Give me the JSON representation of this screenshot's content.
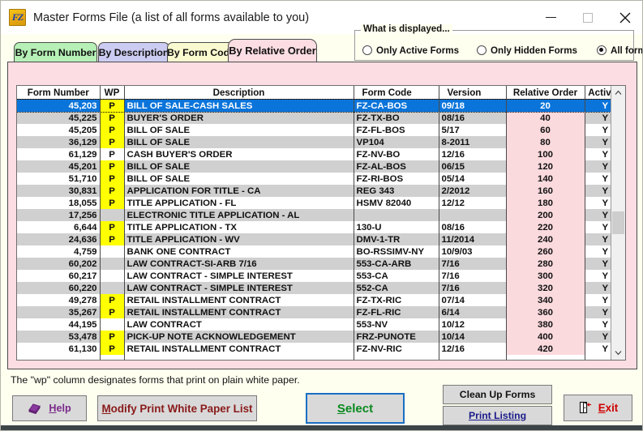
{
  "window": {
    "title": "Master Forms File (a list of all forms available to you)",
    "app_icon": "fz-app-icon",
    "controls": {
      "minimize": "minimize-icon",
      "maximize": "maximize-icon",
      "close": "close-icon"
    }
  },
  "tabs": [
    {
      "label": "By Form Number",
      "active": false,
      "color": "#b6f0b6"
    },
    {
      "label": "By Description",
      "active": false,
      "color": "#ccccf2"
    },
    {
      "label": "By Form Code",
      "active": false,
      "color": "#fafad0"
    },
    {
      "label": "By Relative Order",
      "active": true,
      "color": "#fcdde3"
    }
  ],
  "display_filter": {
    "legend": "What is displayed...",
    "options": [
      {
        "label": "Only Active Forms",
        "selected": false
      },
      {
        "label": "Only Hidden Forms",
        "selected": false
      },
      {
        "label": "All forms",
        "selected": true
      }
    ]
  },
  "grid": {
    "columns": [
      "Form Number",
      "WP",
      "Description",
      "Form Code",
      "Version",
      "Relative Order",
      "Active?"
    ],
    "rows": [
      {
        "form_number": "45,203",
        "wp": "P",
        "description": "BILL OF SALE-CASH SALES",
        "form_code": "FZ-CA-BOS",
        "version": "09/18",
        "relative_order": "20",
        "active": "Y",
        "selected": true,
        "wp_highlight": true
      },
      {
        "form_number": "45,225",
        "wp": "P",
        "description": "BUYER'S ORDER",
        "form_code": "FZ-TX-BO",
        "version": "08/16",
        "relative_order": "40",
        "active": "Y",
        "selected": false,
        "wp_highlight": true
      },
      {
        "form_number": "45,205",
        "wp": "P",
        "description": "BILL OF SALE",
        "form_code": "FZ-FL-BOS",
        "version": "5/17",
        "relative_order": "60",
        "active": "Y",
        "selected": false,
        "wp_highlight": true
      },
      {
        "form_number": "36,129",
        "wp": "P",
        "description": "BILL OF SALE",
        "form_code": "VP104",
        "version": "8-2011",
        "relative_order": "80",
        "active": "Y",
        "selected": false,
        "wp_highlight": true
      },
      {
        "form_number": "61,129",
        "wp": "P",
        "description": "CASH BUYER'S ORDER",
        "form_code": "FZ-NV-BO",
        "version": "12/16",
        "relative_order": "100",
        "active": "Y",
        "selected": false,
        "wp_highlight": false
      },
      {
        "form_number": "45,201",
        "wp": "P",
        "description": "BILL OF SALE",
        "form_code": "FZ-AL-BOS",
        "version": "06/15",
        "relative_order": "120",
        "active": "Y",
        "selected": false,
        "wp_highlight": true
      },
      {
        "form_number": "51,710",
        "wp": "P",
        "description": "BILL OF SALE",
        "form_code": "FZ-RI-BOS",
        "version": "05/14",
        "relative_order": "140",
        "active": "Y",
        "selected": false,
        "wp_highlight": true
      },
      {
        "form_number": "30,831",
        "wp": "P",
        "description": "APPLICATION FOR TITLE - CA",
        "form_code": "REG 343",
        "version": "2/2012",
        "relative_order": "160",
        "active": "Y",
        "selected": false,
        "wp_highlight": true
      },
      {
        "form_number": "18,055",
        "wp": "P",
        "description": "TITLE APPLICATION - FL",
        "form_code": "HSMV 82040",
        "version": "12/12",
        "relative_order": "180",
        "active": "Y",
        "selected": false,
        "wp_highlight": true
      },
      {
        "form_number": "17,256",
        "wp": "",
        "description": "ELECTRONIC TITLE APPLICATION - AL",
        "form_code": "",
        "version": "",
        "relative_order": "200",
        "active": "Y",
        "selected": false,
        "wp_highlight": false
      },
      {
        "form_number": "6,644",
        "wp": "P",
        "description": "TITLE APPLICATION - TX",
        "form_code": "130-U",
        "version": "08/16",
        "relative_order": "220",
        "active": "Y",
        "selected": false,
        "wp_highlight": true
      },
      {
        "form_number": "24,636",
        "wp": "P",
        "description": "TITLE APPLICATION - WV",
        "form_code": "DMV-1-TR",
        "version": "11/2014",
        "relative_order": "240",
        "active": "Y",
        "selected": false,
        "wp_highlight": true
      },
      {
        "form_number": "4,759",
        "wp": "",
        "description": "BANK ONE CONTRACT",
        "form_code": "BO-RSSIMV-NY",
        "version": "10/9/03",
        "relative_order": "260",
        "active": "Y",
        "selected": false,
        "wp_highlight": false
      },
      {
        "form_number": "60,202",
        "wp": "",
        "description": "LAW CONTRACT-SI-ARB 7/16",
        "form_code": "553-CA-ARB",
        "version": "7/16",
        "relative_order": "280",
        "active": "Y",
        "selected": false,
        "wp_highlight": false
      },
      {
        "form_number": "60,217",
        "wp": "",
        "description": "LAW CONTRACT - SIMPLE INTEREST",
        "form_code": "553-CA",
        "version": "7/16",
        "relative_order": "300",
        "active": "Y",
        "selected": false,
        "wp_highlight": false
      },
      {
        "form_number": "60,220",
        "wp": "",
        "description": "LAW CONTRACT - SIMPLE INTEREST",
        "form_code": "552-CA",
        "version": "7/16",
        "relative_order": "320",
        "active": "Y",
        "selected": false,
        "wp_highlight": false
      },
      {
        "form_number": "49,278",
        "wp": "P",
        "description": "RETAIL INSTALLMENT CONTRACT",
        "form_code": "FZ-TX-RIC",
        "version": "07/14",
        "relative_order": "340",
        "active": "Y",
        "selected": false,
        "wp_highlight": true
      },
      {
        "form_number": "35,267",
        "wp": "P",
        "description": "RETAIL INSTALLMENT CONTRACT",
        "form_code": "FZ-FL-RIC",
        "version": "6/14",
        "relative_order": "360",
        "active": "Y",
        "selected": false,
        "wp_highlight": true
      },
      {
        "form_number": "44,195",
        "wp": "",
        "description": "LAW CONTRACT",
        "form_code": "553-NV",
        "version": "10/12",
        "relative_order": "380",
        "active": "Y",
        "selected": false,
        "wp_highlight": false
      },
      {
        "form_number": "53,478",
        "wp": "P",
        "description": "PICK-UP NOTE ACKNOWLEDGEMENT",
        "form_code": "FRZ-PUNOTE",
        "version": "10/14",
        "relative_order": "400",
        "active": "Y",
        "selected": false,
        "wp_highlight": true
      },
      {
        "form_number": "61,130",
        "wp": "P",
        "description": "RETAIL INSTALLMENT CONTRACT",
        "form_code": "FZ-NV-RIC",
        "version": "12/16",
        "relative_order": "420",
        "active": "Y",
        "selected": false,
        "wp_highlight": true
      }
    ]
  },
  "footer": {
    "note": "The \"wp\" column designates forms that print on plain white paper.",
    "buttons": {
      "help": {
        "label": "Help",
        "accel": "H",
        "icon": "book-icon"
      },
      "modify": {
        "label": "Modify Print White Paper List",
        "accel": "M"
      },
      "select": {
        "label": "Select",
        "accel": "S"
      },
      "cleanup": {
        "label": "Clean Up Forms"
      },
      "print": {
        "label": "Print Listing"
      },
      "exit": {
        "label": "Exit",
        "accel": "E",
        "icon": "exit-door-icon"
      }
    }
  },
  "colors": {
    "selection": "#0a74da",
    "wp_flag": "#ffff00",
    "relative_order_bg": "#fbdade",
    "panel_bg": "#fcdde3",
    "window_bg": "#fffff0"
  }
}
